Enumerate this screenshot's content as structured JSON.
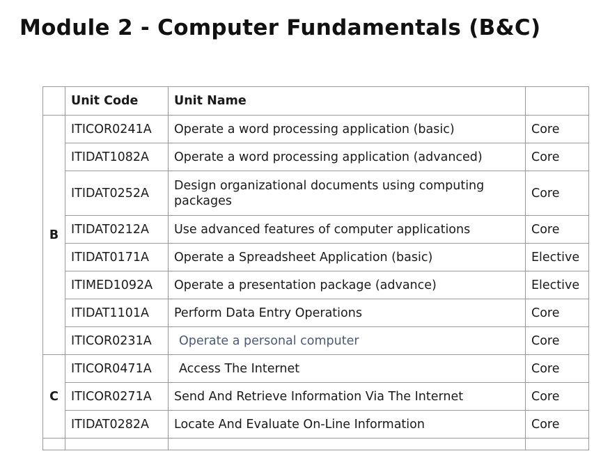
{
  "page": {
    "title": "Module 2 - Computer Fundamentals (B&C)"
  },
  "table": {
    "headers": {
      "group": "",
      "code": "Unit Code",
      "name": "Unit Name",
      "type": ""
    },
    "group_b": "B",
    "group_c": "C",
    "rows": [
      {
        "code": "ITICOR0241A",
        "name": "Operate a word processing application (basic)",
        "type": "Core"
      },
      {
        "code": "ITIDAT1082A",
        "name": "Operate a word processing application (advanced)",
        "type": "Core"
      },
      {
        "code": "ITIDAT0252A",
        "name": "Design organizational documents using computing packages",
        "type": "Core"
      },
      {
        "code": "ITIDAT0212A",
        "name": "Use advanced features of computer applications",
        "type": "Core"
      },
      {
        "code": "ITIDAT0171A",
        "name": "Operate a Spreadsheet Application (basic)",
        "type": "Elective"
      },
      {
        "code": "ITIMED1092A",
        "name": "Operate a presentation package (advance)",
        "type": "Elective"
      },
      {
        "code": "ITIDAT1101A",
        "name": "Perform Data Entry Operations",
        "type": "Core"
      },
      {
        "code": "ITICOR0231A",
        "name": "Operate a personal computer",
        "type": "Core"
      },
      {
        "code": "ITICOR0471A",
        "name": "Access The Internet",
        "type": "Core"
      },
      {
        "code": "ITICOR0271A",
        "name": "Send And Retrieve Information Via The Internet",
        "type": "Core"
      },
      {
        "code": "ITIDAT0282A",
        "name": "Locate And Evaluate On-Line Information",
        "type": "Core"
      }
    ]
  },
  "colors": {
    "text": "#1a1a1a",
    "border": "#9a9a9a",
    "muted_link_text": "#4a5a7a"
  }
}
